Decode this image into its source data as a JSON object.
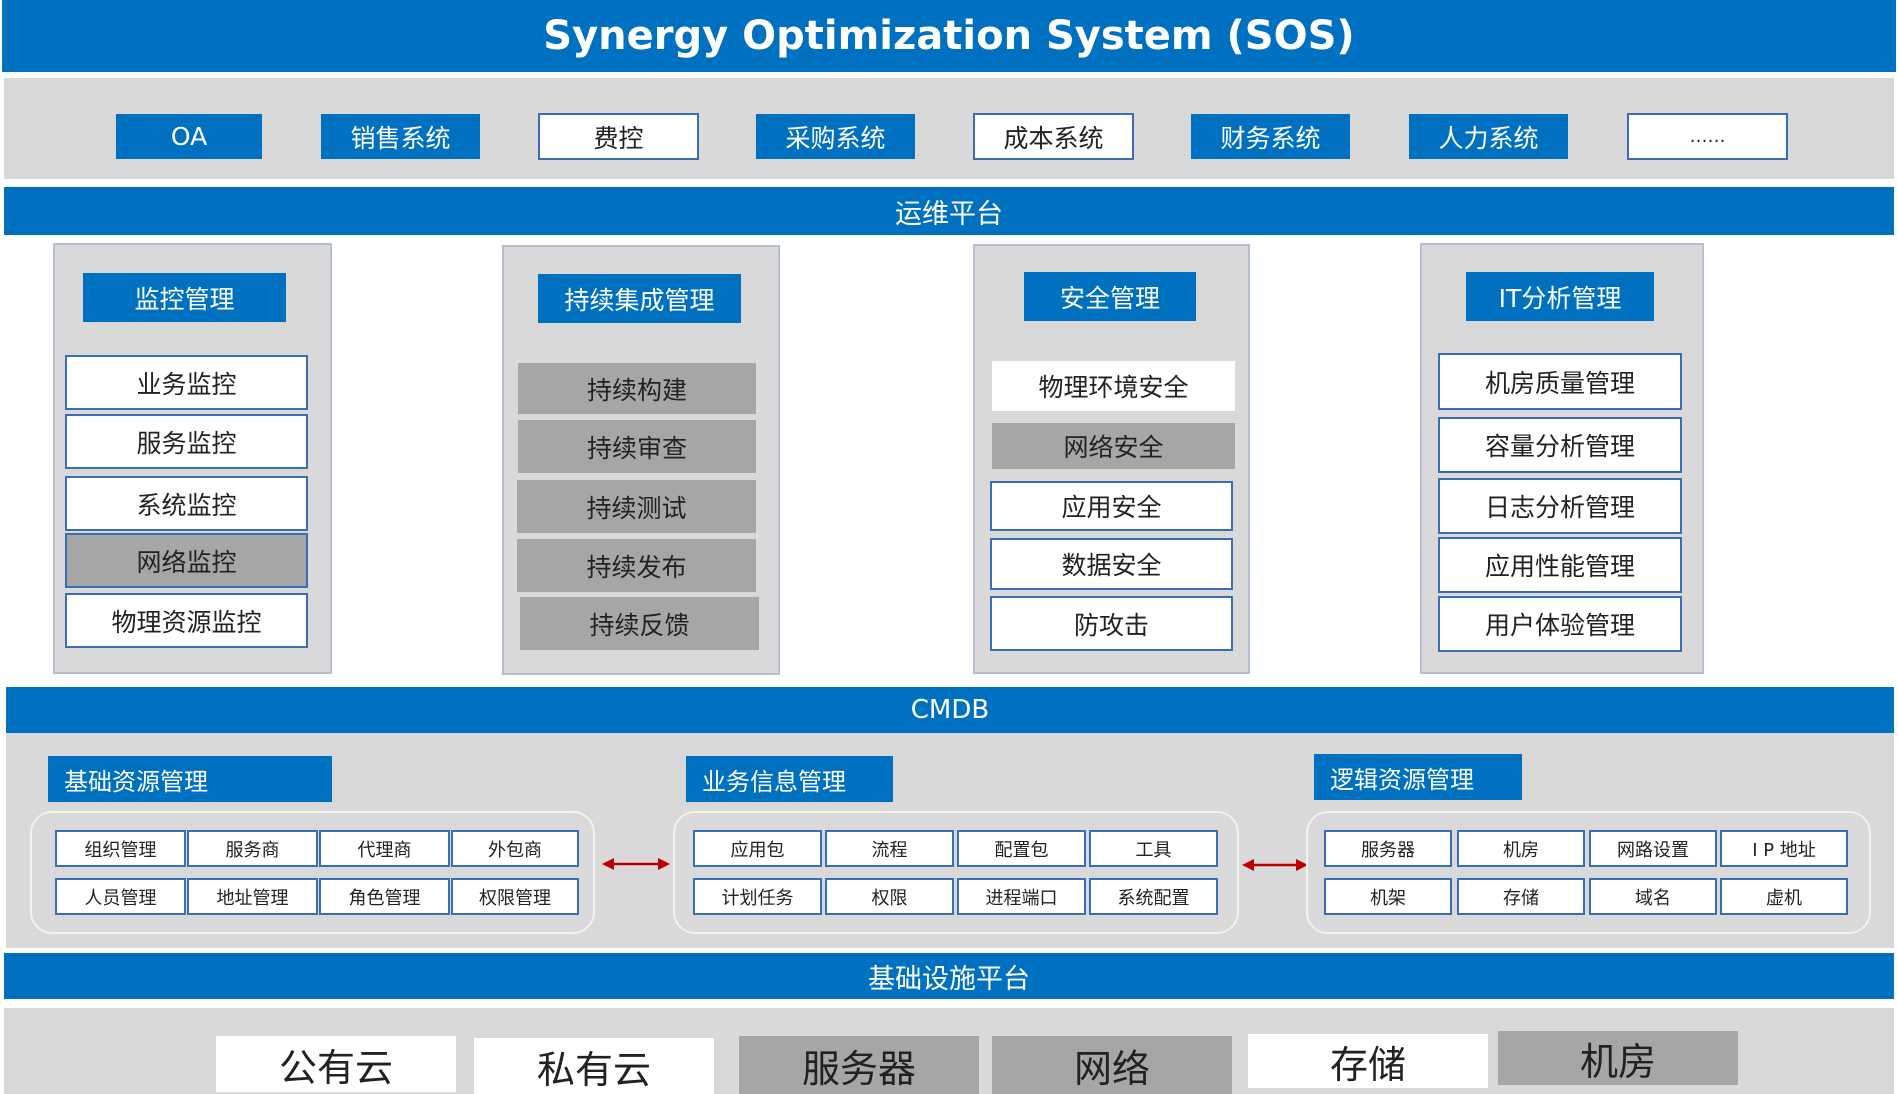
{
  "title": "Synergy Optimization System (SOS)",
  "systems": [
    "OA",
    "销售系统",
    "费控",
    "采购系统",
    "成本系统",
    "财务系统",
    "人力系统",
    "……"
  ],
  "ops_platform": "运维平台",
  "modules": [
    {
      "title": "监控管理",
      "items": [
        "业务监控",
        "服务监控",
        "系统监控",
        "网络监控",
        "物理资源监控"
      ]
    },
    {
      "title": "持续集成管理",
      "items": [
        "持续构建",
        "持续审查",
        "持续测试",
        "持续发布",
        "持续反馈"
      ]
    },
    {
      "title": "安全管理",
      "items": [
        "物理环境安全",
        "网络安全",
        "应用安全",
        "数据安全",
        "防攻击"
      ]
    },
    {
      "title": "IT分析管理",
      "items": [
        "机房质量管理",
        "容量分析管理",
        "日志分析管理",
        "应用性能管理",
        "用户体验管理"
      ]
    }
  ],
  "cmdb": "CMDB",
  "groups": [
    {
      "title": "基础资源管理",
      "row1": [
        "组织管理",
        "服务商",
        "代理商",
        "外包商"
      ],
      "row2": [
        "人员管理",
        "地址管理",
        "角色管理",
        "权限管理"
      ]
    },
    {
      "title": "业务信息管理",
      "row1": [
        "应用包",
        "流程",
        "配置包",
        "工具"
      ],
      "row2": [
        "计划任务",
        "权限",
        "进程端口",
        "系统配置"
      ]
    },
    {
      "title": "逻辑资源管理",
      "row1": [
        "服务器",
        "机房",
        "网路设置",
        "I P 地址"
      ],
      "row2": [
        "机架",
        "存储",
        "域名",
        "虚机"
      ]
    }
  ],
  "infra_platform": "基础设施平台",
  "infra": [
    "公有云",
    "私有云",
    "服务器",
    "网络",
    "存储",
    "机房"
  ],
  "colors": {
    "accent": "#0070C0",
    "panel": "#D9D9D9",
    "gray_box": "#A6A6A6",
    "arrow": "#C00000"
  }
}
